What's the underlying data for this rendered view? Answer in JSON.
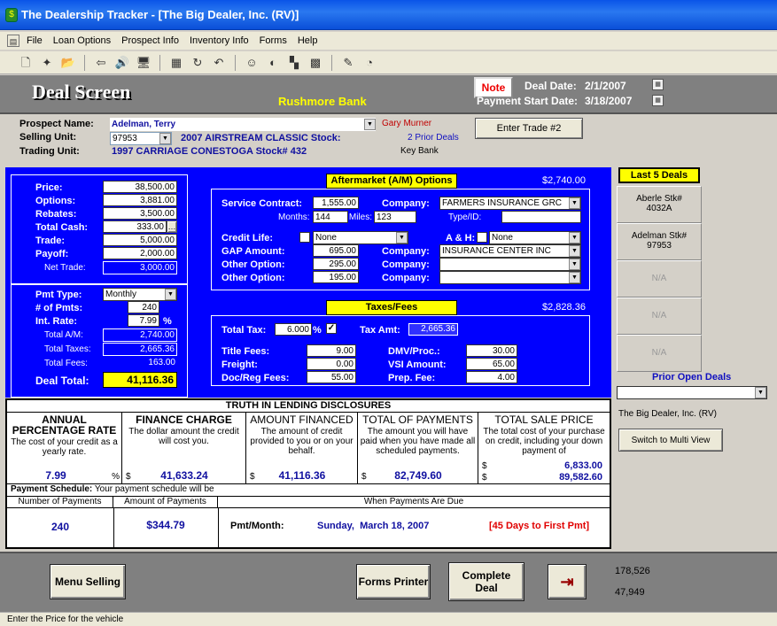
{
  "window": {
    "title": "The Dealership Tracker - [The Big Dealer, Inc. (RV)]"
  },
  "menu": [
    "File",
    "Loan Options",
    "Prospect Info",
    "Inventory Info",
    "Forms",
    "Help"
  ],
  "header": {
    "title": "Deal Screen",
    "bank": "Rushmore Bank",
    "note_label": "Note",
    "deal_date_label": "Deal Date:",
    "deal_date": "2/1/2007",
    "pay_start_label": "Payment Start Date:",
    "pay_start": "3/18/2007"
  },
  "prospect": {
    "name_label": "Prospect Name:",
    "name": "Adelman, Terry",
    "selling_label": "Selling Unit:",
    "selling_stock": "97953",
    "selling_desc": "2007 AIRSTREAM CLASSIC Stock:",
    "trading_label": "Trading Unit:",
    "trading_desc": "1997 CARRIAGE CONESTOGA Stock# 432",
    "salesperson": "Gary Murner",
    "prior_deals": "2 Prior Deals",
    "key_bank": "Key Bank",
    "enter_trade": "Enter Trade #2"
  },
  "pricing": {
    "price_label": "Price:",
    "price": "38,500.00",
    "options_label": "Options:",
    "options": "3,881.00",
    "rebates_label": "Rebates:",
    "rebates": "3,500.00",
    "cash_label": "Total Cash:",
    "cash": "333.00",
    "trade_label": "Trade:",
    "trade": "5,000.00",
    "payoff_label": "Payoff:",
    "payoff": "2,000.00",
    "net_trade_label": "Net Trade:",
    "net_trade": "3,000.00"
  },
  "payment": {
    "type_label": "Pmt Type:",
    "type": "Monthly",
    "num_label": "# of Pmts:",
    "num": "240",
    "rate_label": "Int. Rate:",
    "rate": "7.99",
    "pct": "%",
    "total_am_label": "Total A/M:",
    "total_am": "2,740.00",
    "total_taxes_label": "Total Taxes:",
    "total_taxes": "2,665.36",
    "total_fees_label": "Total Fees:",
    "total_fees": "163.00",
    "deal_total_label": "Deal Total:",
    "deal_total": "41,116.36"
  },
  "aftermarket": {
    "title": "Aftermarket (A/M) Options",
    "total": "$2,740.00",
    "service_label": "Service Contract:",
    "service": "1,555.00",
    "company_label": "Company:",
    "service_company": "FARMERS INSURANCE GRC",
    "months_label": "Months:",
    "months": "144",
    "miles_label": "Miles:",
    "miles": "123",
    "type_label": "Type/ID:",
    "credit_life_label": "Credit Life:",
    "credit_life": "None",
    "ah_label": "A & H:",
    "ah": "None",
    "gap_label": "GAP Amount:",
    "gap": "695.00",
    "gap_company": "INSURANCE CENTER INC",
    "other1_label": "Other Option:",
    "other1": "295.00",
    "other2_label": "Other Option:",
    "other2": "195.00"
  },
  "taxes": {
    "title": "Taxes/Fees",
    "total": "$2,828.36",
    "total_tax_label": "Total Tax:",
    "rate": "6.000",
    "pct": "%",
    "tax_amt_label": "Tax Amt:",
    "tax_amt": "2,665.36",
    "title_label": "Title Fees:",
    "title_fees": "9.00",
    "freight_label": "Freight:",
    "freight": "0.00",
    "doc_label": "Doc/Reg Fees:",
    "doc": "55.00",
    "dmv_label": "DMV/Proc.:",
    "dmv": "30.00",
    "vsi_label": "VSI Amount:",
    "vsi": "65.00",
    "prep_label": "Prep. Fee:",
    "prep": "4.00"
  },
  "last_deals": {
    "title": "Last 5 Deals",
    "items": [
      "Aberle Stk#\n4032A",
      "Adelman Stk#\n97953",
      "N/A",
      "N/A",
      "N/A"
    ]
  },
  "prior_open": {
    "title": "Prior Open Deals",
    "dealer": "The Big Dealer, Inc. (RV)",
    "switch": "Switch to Multi View"
  },
  "tila": {
    "title": "TRUTH IN LENDING DISCLOSURES",
    "apr_head": "ANNUAL PERCENTAGE RATE",
    "apr_desc": "The cost of your credit as a yearly rate.",
    "apr": "7.99",
    "fc_head": "FINANCE CHARGE",
    "fc_desc": "The dollar amount the credit will cost you.",
    "fc": "41,633.24",
    "af_head": "AMOUNT FINANCED",
    "af_desc": "The amount of credit provided to you or on your behalf.",
    "af": "41,116.36",
    "tp_head": "TOTAL OF PAYMENTS",
    "tp_desc": "The amount you will have paid when you have made all scheduled payments.",
    "tp": "82,749.60",
    "ts_head": "TOTAL SALE PRICE",
    "ts_desc": "The total cost of your purchase on credit, including your down payment of",
    "down": "6,833.00",
    "ts": "89,582.60",
    "sched_label": "Payment Schedule:",
    "sched_text": "Your payment schedule will be",
    "col_num": "Number of Payments",
    "col_amt": "Amount of Payments",
    "col_due": "When Payments Are Due",
    "num": "240",
    "amt": "$344.79",
    "pmt_label": "Pmt/Month:",
    "due": "Sunday,  March 18, 2007",
    "days": "[45 Days to First Pmt]"
  },
  "bottom": {
    "menu_selling": "Menu Selling",
    "forms_printer": "Forms Printer",
    "complete": "Complete Deal",
    "num1": "178,526",
    "num2": "47,949"
  },
  "status": "Enter the Price for the vehicle"
}
